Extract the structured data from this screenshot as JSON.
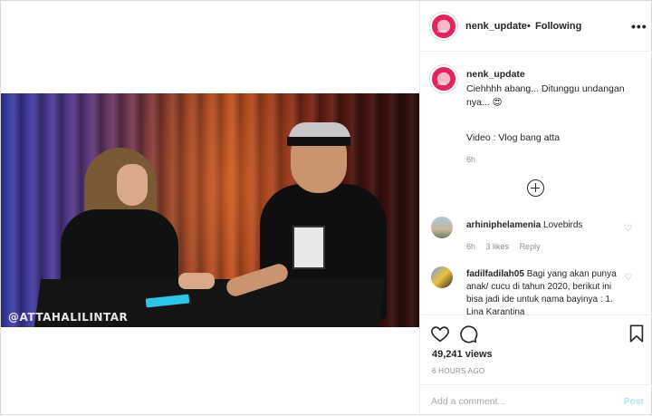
{
  "post": {
    "video_watermark": "@ATTAHALILINTAR"
  },
  "header": {
    "username": "nenk_update",
    "separator": "•",
    "follow_status": "Following",
    "more_label": "•••"
  },
  "caption": {
    "username": "nenk_update",
    "text": "Ciehhhh abang... Ditunggu undangan nya... 😍",
    "credit": "Video : Vlog bang atta",
    "time": "6h"
  },
  "comments": [
    {
      "username": "arhiniphelamenia",
      "text": "Lovebirds",
      "time": "6h",
      "likes": "3 likes",
      "reply": "Reply"
    },
    {
      "username": "fadilfadilah05",
      "text": "Bagi yang akan punya anak/ cucu di tahun 2020, berikut ini bisa jadi ide untuk nama bayinya : 1. Lina Karantina",
      "time": "",
      "likes": "",
      "reply": ""
    }
  ],
  "actions": {
    "views": "49,241 views",
    "posted_ago": "6 HOURS AGO"
  },
  "add_comment": {
    "placeholder": "Add a comment...",
    "post_label": "Post"
  },
  "icons": {
    "heart": "heart-icon",
    "comment": "comment-icon",
    "bookmark": "bookmark-icon",
    "load_more": "plus-circle-icon",
    "more": "more-options-icon"
  },
  "colors": {
    "accent": "#0095f6",
    "post_disabled": "#b2dffc",
    "muted": "#8e8e8e",
    "border": "#dbdbdb"
  }
}
